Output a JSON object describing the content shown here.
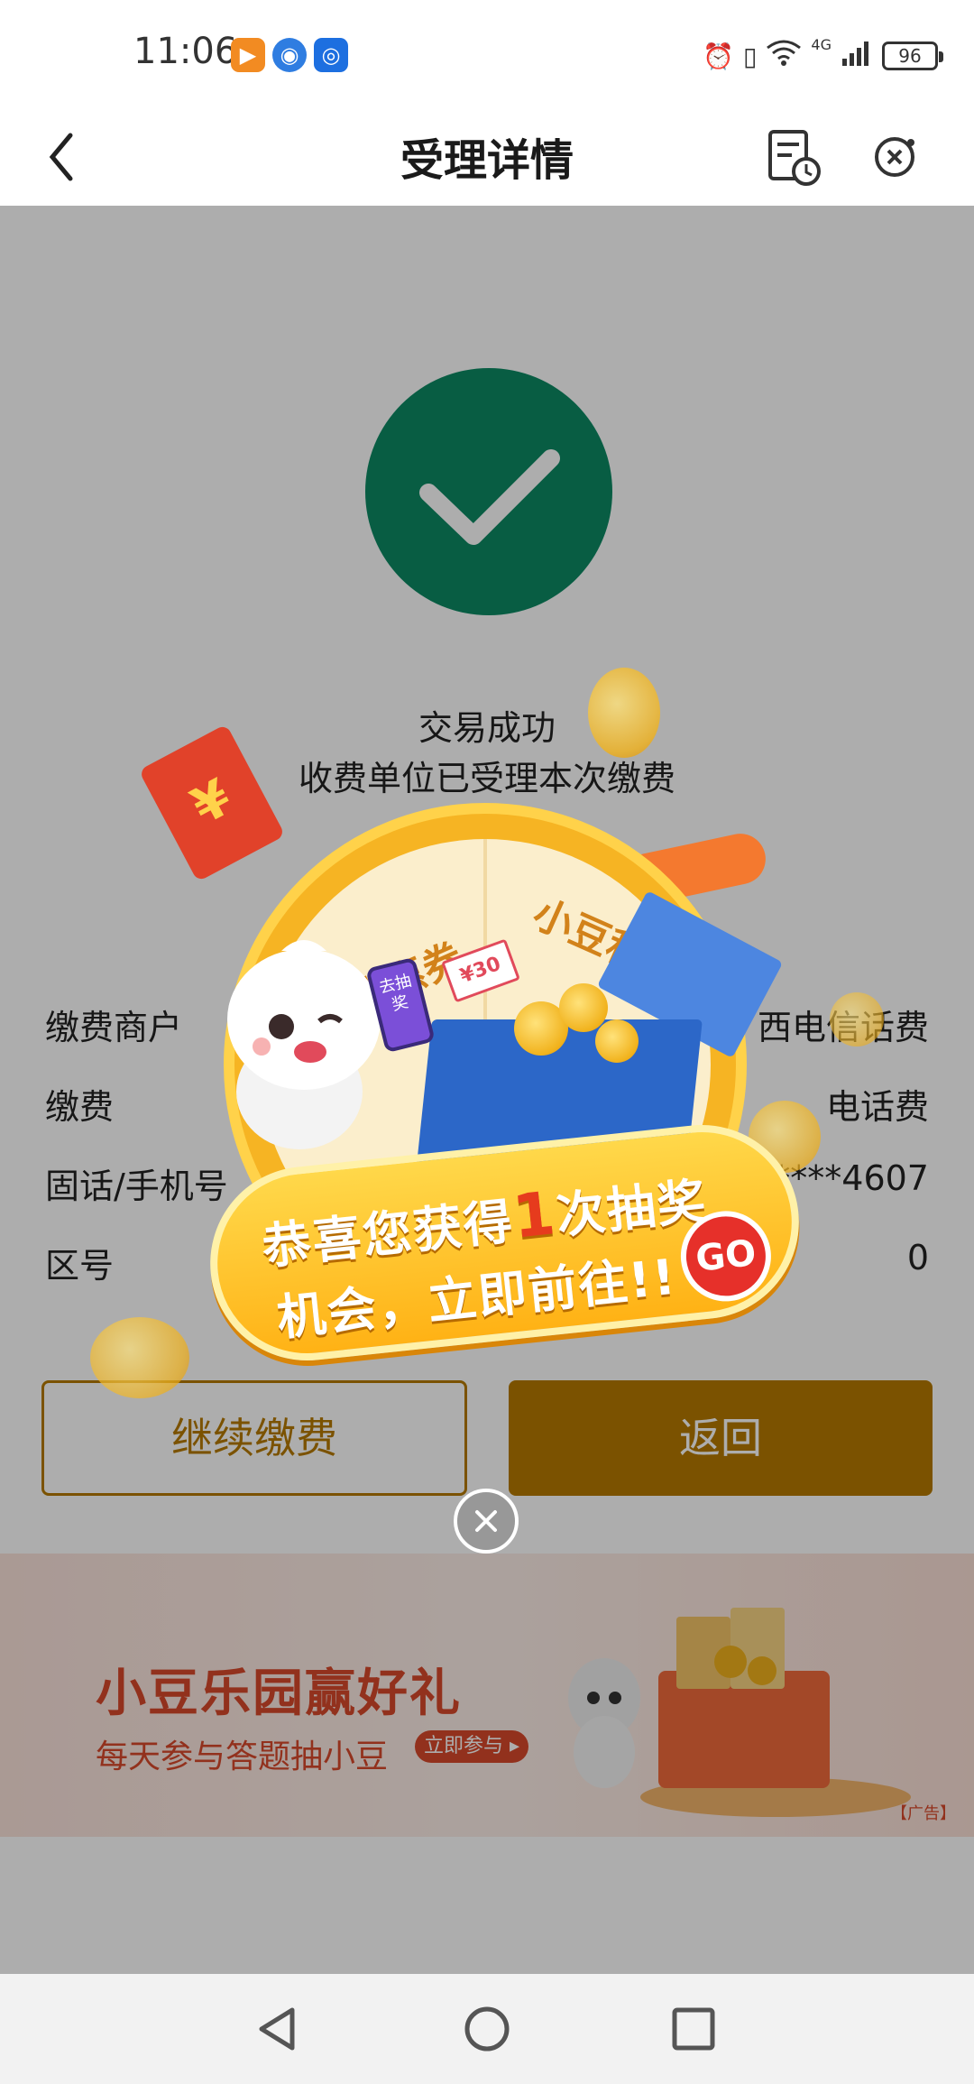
{
  "status_bar": {
    "time": "11:06",
    "network": "4G",
    "battery": "96",
    "apps": [
      "video-app-icon",
      "browser-app-icon",
      "assistant-app-icon"
    ]
  },
  "header": {
    "title": "受理详情",
    "back_icon": "chevron-left-icon",
    "right_icons": [
      "history-record-icon",
      "close-mini-program-icon"
    ]
  },
  "result": {
    "status": "交易成功",
    "message": "收费单位已受理本次缴费",
    "status_color": "#0c8a64"
  },
  "details": [
    {
      "key": "缴费商户",
      "value": "西电信话费"
    },
    {
      "key": "缴费",
      "value": "电话费"
    },
    {
      "key": "固话/手机号",
      "value": "****4607"
    },
    {
      "key": "区号",
      "value": "0"
    }
  ],
  "actions": {
    "continue_label": "继续缴费",
    "return_label": "返回",
    "accent_color": "#b67a00"
  },
  "banner": {
    "title": "小豆乐园赢好礼",
    "subtitle": "每天参与答题抽小豆",
    "cta": "立即参与 ▸",
    "ad_tag": "【广告】"
  },
  "popup": {
    "wheel_left": "优惠券",
    "wheel_right": "小豆积分",
    "phone_label": "去抽奖",
    "coupon_label": "¥30",
    "line1_prefix": "恭喜您获得",
    "line1_number": "1",
    "line1_suffix": "次抽奖",
    "line2": "机会，立即前往!!",
    "go_label": "GO",
    "close_icon": "close-circle-icon"
  },
  "nav": {
    "items": [
      "back-triangle-icon",
      "home-circle-icon",
      "recents-square-icon"
    ]
  }
}
